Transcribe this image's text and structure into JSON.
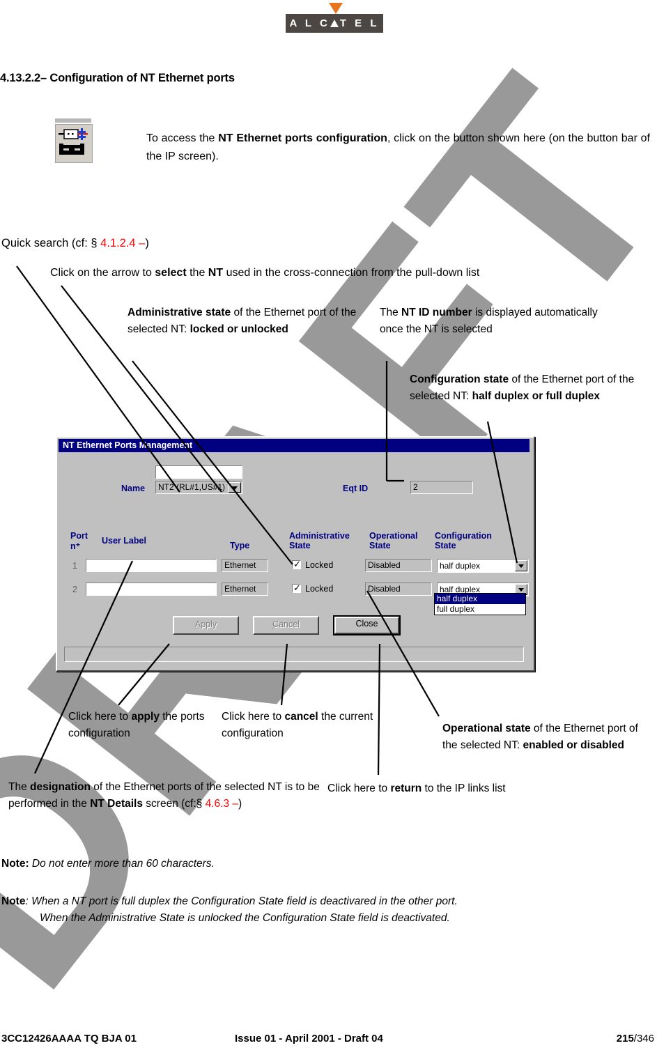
{
  "logo": {
    "brand": "ALCATEL",
    "brand_parts": [
      "A",
      "L",
      "C",
      "T",
      "E",
      "L"
    ],
    "box_color": "#4C4742",
    "triangle_color": "#E8741E"
  },
  "heading": "4.13.2.2–  Configuration of NT Ethernet ports",
  "intro": {
    "before": "To access the ",
    "bold": "NT Ethernet ports configuration",
    "after": ", click on the button shown here (on the button bar of the IP screen)."
  },
  "quick_search": {
    "prefix": "Quick search (cf: § ",
    "ref": "4.1.2.4 –",
    "suffix": ")"
  },
  "callouts": {
    "select": {
      "p1": "Click on the arrow to ",
      "b1": "select",
      "p2": " the ",
      "b2": "NT",
      "p3": " used in the cross-connection from the pull-down list"
    },
    "admin": {
      "b1": "Administrative state",
      "p1": " of the Ethernet port of the selected NT: ",
      "b2": "locked or unlocked"
    },
    "ntid": {
      "p1": "The ",
      "b1": "NT ID number",
      "p2": " is displayed automatically once the NT is selected"
    },
    "config": {
      "b1": "Configuration state",
      "p1": " of the Ethernet port of the selected NT: ",
      "b2": "half duplex or full duplex"
    },
    "apply": {
      "p1": "Click here to ",
      "b1": "apply",
      "p2": " the ports configuration"
    },
    "cancel": {
      "p1": "Click here to ",
      "b1": "cancel",
      "p2": " the current configuration"
    },
    "operational": {
      "b1": "Operational state",
      "p1": " of the Ethernet port of the selected NT: ",
      "b2": "enabled or disabled"
    },
    "designation": {
      "p1": "The ",
      "b1": "designation",
      "p2": " of the Ethernet ports of the selected NT is to be performed in the ",
      "b2": "NT Details",
      "p3": " screen (cf:§ ",
      "ref": "4.6.3 –",
      "p4": ")"
    },
    "return": {
      "p1": "Click here to ",
      "b1": "return",
      "p2": " to the IP links list"
    }
  },
  "dialog": {
    "title": "NT Ethernet Ports Management",
    "name_label": "Name",
    "name_value": "NT2 (RL#1,US#1)",
    "name_edit_value": "",
    "eqtid_label": "Eqt ID",
    "eqtid_value": "2",
    "headers": {
      "port": "Port",
      "port_sub": "n⁺",
      "user_label": "User Label",
      "type": "Type",
      "admin_state": "Administrative State",
      "admin_state_l1": "Administrative",
      "admin_state_l2": "State",
      "oper_state_l1": "Operational",
      "oper_state_l2": "State",
      "config_state_l1": "Configuration",
      "config_state_l2": "State"
    },
    "rows": [
      {
        "port": "1",
        "user_label": "",
        "type": "Ethernet",
        "admin_checked": true,
        "admin_label": "Locked",
        "operational": "Disabled",
        "configuration": "half duplex"
      },
      {
        "port": "2",
        "user_label": "",
        "type": "Ethernet",
        "admin_checked": true,
        "admin_label": "Locked",
        "operational": "Disabled",
        "configuration": "half duplex"
      }
    ],
    "dropdown_open": {
      "options": [
        "half duplex",
        "full duplex"
      ],
      "selected": "half duplex"
    },
    "buttons": {
      "apply": "Apply",
      "apply_mnemonic": "A",
      "cancel": "Cancel",
      "cancel_mnemonic": "C",
      "close": "Close"
    },
    "statusbar_text": "",
    "colors": {
      "titlebar": "#000080",
      "face": "#c0c0c0",
      "label": "#000080",
      "highlight": "#000080"
    }
  },
  "notes": {
    "note1_label": "Note:",
    "note1_text": "  Do not enter more than 60 characters.",
    "note2_label": "Note",
    "note2_line1": ": When a NT port is full duplex the Configuration State field is deactivared in the other port.",
    "note2_line2": "When the Administrative State is unlocked the Configuration State field is deactivated."
  },
  "footer": {
    "left": "3CC12426AAAA TQ BJA 01",
    "middle": "Issue 01 - April 2001 - Draft 04",
    "page_current": "215",
    "page_sep": "/",
    "page_total": "346"
  },
  "watermark": {
    "text": "DRAFT",
    "color": "#999999"
  }
}
